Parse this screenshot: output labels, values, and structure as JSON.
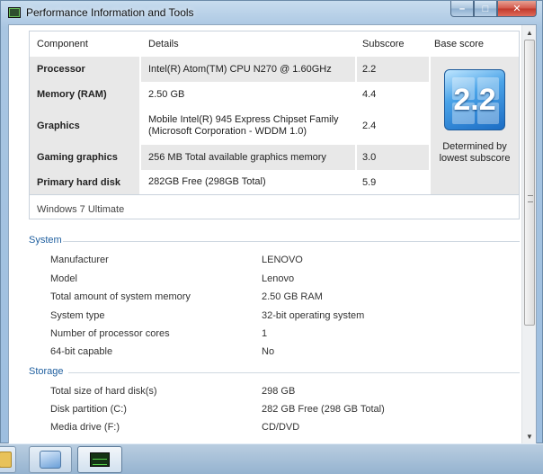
{
  "window": {
    "title": "Performance Information and Tools"
  },
  "score_table": {
    "headers": {
      "component": "Component",
      "details": "Details",
      "subscore": "Subscore",
      "base_score": "Base score"
    },
    "rows": [
      {
        "component": "Processor",
        "details": "Intel(R) Atom(TM) CPU N270 @ 1.60GHz",
        "subscore": "2.2"
      },
      {
        "component": "Memory (RAM)",
        "details": "2.50 GB",
        "subscore": "4.4"
      },
      {
        "component": "Graphics",
        "details_line1": "Mobile Intel(R) 945 Express Chipset Family",
        "details_line2": "(Microsoft Corporation - WDDM 1.0)",
        "subscore": "2.4"
      },
      {
        "component": "Gaming graphics",
        "details": "256 MB Total available graphics memory",
        "subscore": "3.0"
      },
      {
        "component": "Primary hard disk",
        "details": "282GB Free (298GB Total)",
        "subscore": "5.9"
      }
    ],
    "base_score": {
      "value": "2.2",
      "note_line1": "Determined by",
      "note_line2": "lowest subscore"
    },
    "os_edition": "Windows 7 Ultimate"
  },
  "system": {
    "heading": "System",
    "properties": [
      {
        "label": "Manufacturer",
        "value": "LENOVO"
      },
      {
        "label": "Model",
        "value": "Lenovo"
      },
      {
        "label": "Total amount of system memory",
        "value": "2.50 GB RAM"
      },
      {
        "label": "System type",
        "value": "32-bit operating system"
      },
      {
        "label": "Number of processor cores",
        "value": "1"
      },
      {
        "label": "64-bit capable",
        "value": "No"
      }
    ]
  },
  "storage": {
    "heading": "Storage",
    "properties": [
      {
        "label": "Total size of hard disk(s)",
        "value": "298 GB"
      },
      {
        "label": "Disk partition (C:)",
        "value": "282 GB Free (298 GB Total)"
      },
      {
        "label": "Media drive (F:)",
        "value": "CD/DVD"
      }
    ]
  },
  "taskbar": {
    "items": [
      "windows-explorer",
      "control-panel",
      "performance-information-and-tools"
    ]
  },
  "colors": {
    "section_heading": "#1f5f9f",
    "row_shade": "#e8e8e8",
    "badge_blue": "#1b6cc4"
  }
}
